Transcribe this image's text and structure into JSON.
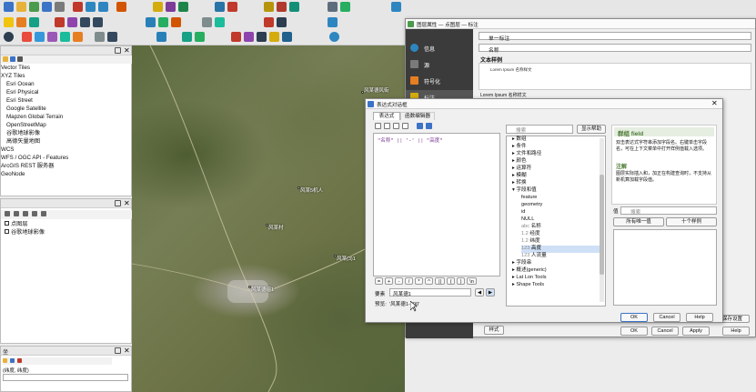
{
  "colors": {
    "accent": "#3b73c6",
    "sidebar_dark": "#3b3b3b",
    "selection": "#cfe0f6",
    "map_green": "#5c6a3e"
  },
  "browser_panel": {
    "items": [
      "Vector Tiles",
      "XYZ Tiles",
      "Esri Ocean",
      "Esri Physical",
      "Esri Street",
      "Google Satellite",
      "Mapzen Global Terrain",
      "OpenStreetMap",
      "谷歌地球影像",
      "高德矢量地图",
      "WCS",
      "WFS / OGC API - Features",
      "ArcGIS REST 服务器",
      "GeoNode"
    ]
  },
  "layers_panel": {
    "items": [
      "点图层",
      "谷歌地球影像"
    ]
  },
  "bottom_panel": {
    "title": "坐",
    "text": "(纬度, 纬度)"
  },
  "map": {
    "labels": [
      "风某德风街",
      "风某5机人",
      "风某村",
      "风某(3)1",
      "风某德组1"
    ]
  },
  "layer_props": {
    "title": "图层属性 — 点图层 — 标注",
    "mode": "单一标注",
    "value_label": "名称",
    "section_text": "文本样例",
    "sample_text": "Lorem Ipsum 名称样文",
    "sidebar": [
      "信息",
      "源",
      "符号化",
      "标注"
    ],
    "ok": "OK",
    "cancel": "Cancel",
    "apply": "Apply",
    "help": "Help",
    "style_btn": "样式"
  },
  "expr_dialog": {
    "title": "表达式对话框",
    "tab_expression": "表达式",
    "tab_functions": "函数编辑器",
    "expression_text": "\"名称\" || '-' || \"高度\"",
    "search_placeholder": "搜索",
    "show_help": "显示帮助",
    "tree": [
      "数组",
      "条件",
      "文件和路径",
      "颜色",
      "运算符",
      "模糊",
      "转换",
      "字段和值",
      "feature",
      "geometry",
      "id",
      "NULL",
      "名称",
      "经度",
      "纬度",
      "高度",
      "人流量",
      "字段串",
      "概述(generic)",
      "Lat Lon Tools",
      "Shape Tools"
    ],
    "feature_label": "要素",
    "feature_value": "风某德1",
    "preview_label": "预览:",
    "preview_value": "'风某德1-300'",
    "ok": "OK",
    "cancel": "Cancel",
    "help": "Help",
    "help_panel": {
      "title": "群组 field",
      "body": "双击表达式字符串添加字段名。右键单击字段名，可在上下文菜单中打开样例值载入选项。",
      "notes_title": "注解",
      "notes": "图层实际插入和，加正在构建查询时，不支持从新机算加载字段值。",
      "values_label": "值",
      "search_placeholder": "搜索",
      "all_unique": "所有唯一值",
      "ten_samples": "十个样例"
    }
  },
  "layer_panel_misc": {
    "save_button": "保存设置"
  }
}
